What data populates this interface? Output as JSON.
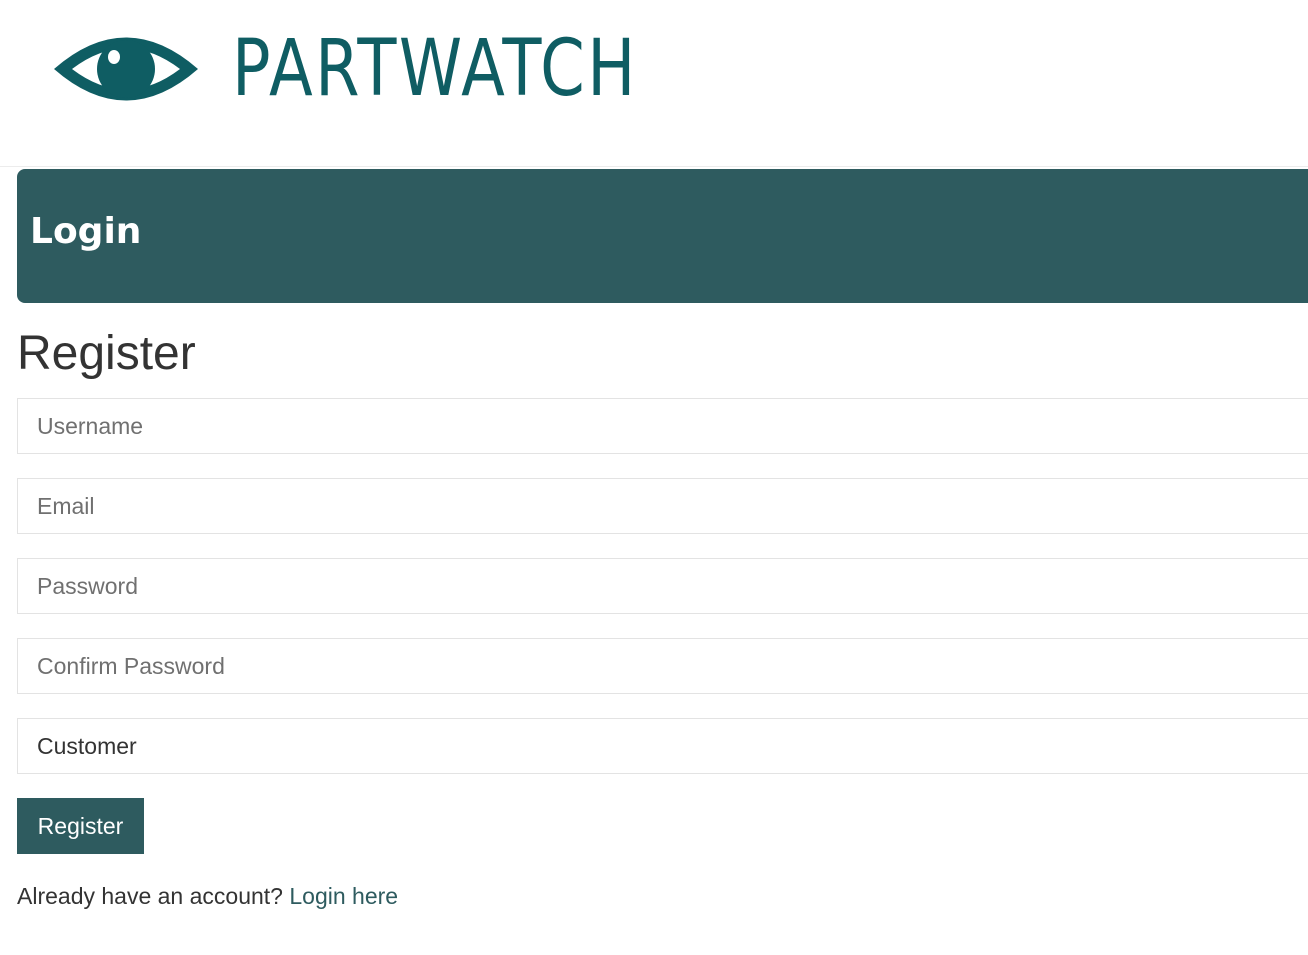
{
  "header": {
    "logo_text": "PARTWATCH",
    "logo_icon": "eye-icon",
    "brand_color": "#0f5d63"
  },
  "banner": {
    "title": "Login",
    "color": "#2e5b5f"
  },
  "form": {
    "title": "Register",
    "username_placeholder": "Username",
    "email_placeholder": "Email",
    "password_placeholder": "Password",
    "confirm_password_placeholder": "Confirm Password",
    "role_selected": "Customer",
    "submit_label": "Register"
  },
  "footer": {
    "prompt": "Already have an account?",
    "login_link": "Login here"
  }
}
